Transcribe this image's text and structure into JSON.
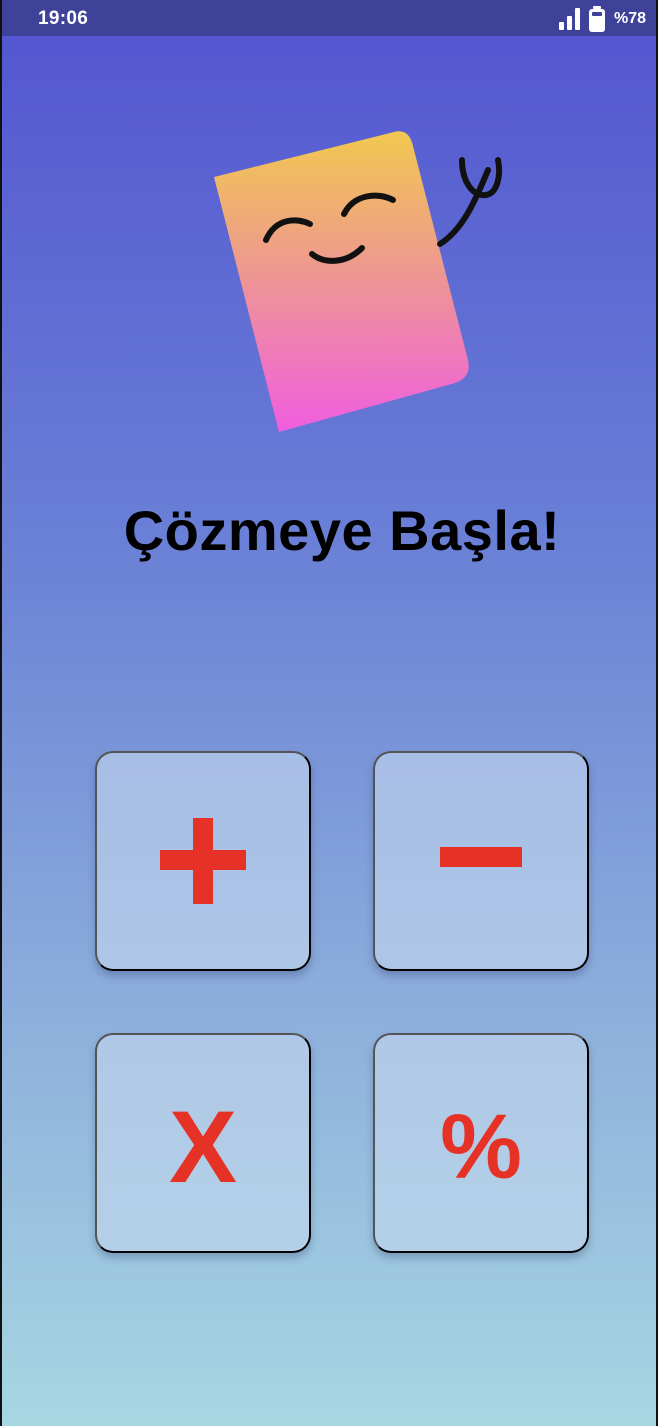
{
  "status_bar": {
    "time": "19:06",
    "battery_percent": "%78",
    "icons": [
      "signal-icon",
      "battery-icon"
    ]
  },
  "mascot": {
    "icon": "smiling-card-mascot-icon",
    "colors": {
      "gradient_top": "#f1c84f",
      "gradient_bottom": "#f05ee0",
      "line": "#111111"
    }
  },
  "main": {
    "title": "Çözmeye Başla!"
  },
  "operations": [
    {
      "id": "plus",
      "label": "+"
    },
    {
      "id": "minus",
      "label": "−"
    },
    {
      "id": "multiply",
      "label": "X"
    },
    {
      "id": "percent",
      "label": "%"
    }
  ],
  "colors": {
    "background_top": "#5254d0",
    "background_bottom": "#a6d7e2",
    "status_bar": "#3e4399",
    "operator_red": "#e63226",
    "button_fill": "#c3d6ee"
  }
}
